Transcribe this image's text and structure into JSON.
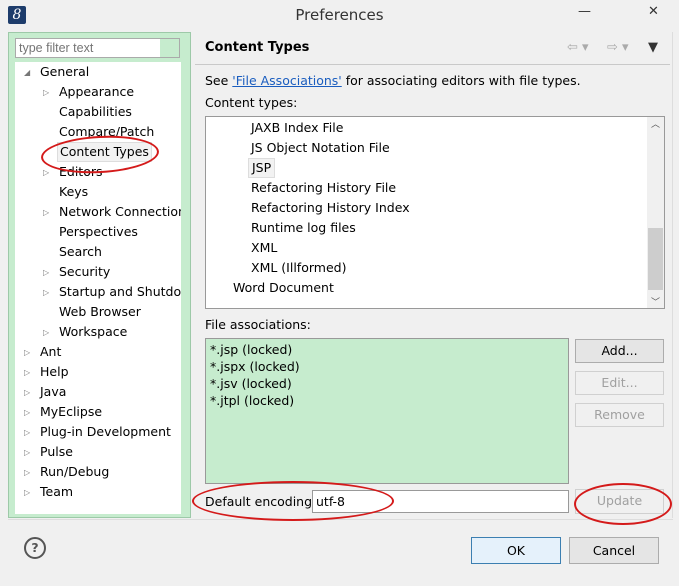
{
  "window": {
    "title": "Preferences",
    "minimize": "—",
    "close": "✕"
  },
  "filter": {
    "placeholder": "type filter text"
  },
  "tree": [
    {
      "label": "General",
      "level": 0,
      "expander": "expanded"
    },
    {
      "label": "Appearance",
      "level": 1,
      "expander": "collapsed"
    },
    {
      "label": "Capabilities",
      "level": 1,
      "expander": "none"
    },
    {
      "label": "Compare/Patch",
      "level": 1,
      "expander": "none"
    },
    {
      "label": "Content Types",
      "level": 1,
      "expander": "none",
      "selected": true
    },
    {
      "label": "Editors",
      "level": 1,
      "expander": "collapsed"
    },
    {
      "label": "Keys",
      "level": 1,
      "expander": "none"
    },
    {
      "label": "Network Connections",
      "level": 1,
      "expander": "collapsed"
    },
    {
      "label": "Perspectives",
      "level": 1,
      "expander": "none"
    },
    {
      "label": "Search",
      "level": 1,
      "expander": "none"
    },
    {
      "label": "Security",
      "level": 1,
      "expander": "collapsed"
    },
    {
      "label": "Startup and Shutdown",
      "level": 1,
      "expander": "collapsed"
    },
    {
      "label": "Web Browser",
      "level": 1,
      "expander": "none"
    },
    {
      "label": "Workspace",
      "level": 1,
      "expander": "collapsed"
    },
    {
      "label": "Ant",
      "level": 0,
      "expander": "collapsed"
    },
    {
      "label": "Help",
      "level": 0,
      "expander": "collapsed"
    },
    {
      "label": "Java",
      "level": 0,
      "expander": "collapsed"
    },
    {
      "label": "MyEclipse",
      "level": 0,
      "expander": "collapsed"
    },
    {
      "label": "Plug-in Development",
      "level": 0,
      "expander": "collapsed"
    },
    {
      "label": "Pulse",
      "level": 0,
      "expander": "collapsed"
    },
    {
      "label": "Run/Debug",
      "level": 0,
      "expander": "collapsed"
    },
    {
      "label": "Team",
      "level": 0,
      "expander": "collapsed"
    }
  ],
  "page": {
    "title": "Content Types",
    "desc_prefix": "See ",
    "desc_link": "'File Associations'",
    "desc_suffix": " for associating editors with file types.",
    "content_types_label": "Content types:",
    "content_types": [
      {
        "label": "JAXB Index File",
        "level": 2
      },
      {
        "label": "JS Object Notation File",
        "level": 2
      },
      {
        "label": "JSP",
        "level": 2,
        "selected": true
      },
      {
        "label": "Refactoring History File",
        "level": 2
      },
      {
        "label": "Refactoring History Index",
        "level": 2
      },
      {
        "label": "Runtime log files",
        "level": 2
      },
      {
        "label": "XML",
        "level": 2
      },
      {
        "label": "XML (Illformed)",
        "level": 2
      },
      {
        "label": "Word Document",
        "level": 1
      }
    ],
    "file_assoc_label": "File associations:",
    "file_associations": [
      "*.jsp (locked)",
      "*.jspx (locked)",
      "*.jsv (locked)",
      "*.jtpl (locked)"
    ],
    "add": "Add...",
    "edit": "Edit...",
    "remove": "Remove",
    "encoding_label": "Default encoding:",
    "encoding_value": "utf-8",
    "update": "Update"
  },
  "footer": {
    "help": "?",
    "ok": "OK",
    "cancel": "Cancel"
  },
  "colors": {
    "tree_bg": "#c6ecce",
    "link": "#1a5dbf",
    "annotation": "#d41a1a"
  }
}
